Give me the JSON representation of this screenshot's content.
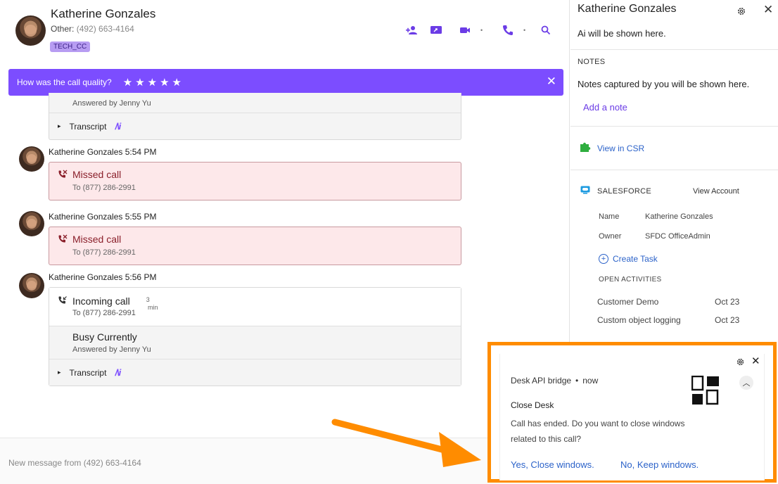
{
  "header": {
    "contact_name": "Katherine Gonzales",
    "phone_label": "Other:",
    "phone_number": "(492) 663-4164",
    "tag": "TECH_CC",
    "actions": [
      "add-user-icon",
      "screen-share-icon",
      "video-icon",
      "phone-icon",
      "search-icon"
    ]
  },
  "rating_bar": {
    "question": "How was the call quality?",
    "stars": [
      "★",
      "★",
      "★",
      "★",
      "★"
    ]
  },
  "timeline": {
    "first_card": {
      "answered_by": "Answered by Jenny Yu",
      "transcript_label": "Transcript",
      "transcript_caret": "▸",
      "ai_glyph": "/\\i"
    },
    "events": [
      {
        "author": "Katherine Gonzales",
        "time": "5:54 PM",
        "title": "Missed call",
        "to": "To (877) 286-2991"
      },
      {
        "author": "Katherine Gonzales",
        "time": "5:55 PM",
        "title": "Missed call",
        "to": "To (877) 286-2991"
      },
      {
        "author": "Katherine Gonzales",
        "time": "5:56 PM",
        "title": "Incoming call",
        "to": "To (877) 286-2991",
        "duration_value": "3",
        "duration_unit": "min",
        "status": "Busy Currently",
        "answered_by": "Answered by Jenny Yu",
        "transcript_label": "Transcript"
      }
    ]
  },
  "footer": {
    "text": "New message from (492) 663-4164"
  },
  "right_panel": {
    "name": "Katherine Gonzales",
    "ai_text": "Ai will be shown here.",
    "notes_heading": "NOTES",
    "notes_text": "Notes captured by you will be shown here.",
    "add_note": "Add a note",
    "view_csr": "View in CSR",
    "salesforce": {
      "heading": "SALESFORCE",
      "view_account": "View Account",
      "fields": [
        {
          "key": "Name",
          "value": "Katherine Gonzales"
        },
        {
          "key": "Owner",
          "value": "SFDC OfficeAdmin"
        }
      ],
      "create_task": "Create Task",
      "open_activities_heading": "OPEN ACTIVITIES",
      "activities": [
        {
          "name": "Customer Demo",
          "date": "Oct 23"
        },
        {
          "name": "Custom object logging",
          "date": "Oct 23"
        }
      ]
    }
  },
  "notification": {
    "app": "Desk API bridge",
    "dot": "•",
    "when": "now",
    "title": "Close Desk",
    "body": "Call has ended. Do you want to close windows related to this call?",
    "yes": "Yes, Close windows.",
    "no": "No, Keep windows.",
    "highlight_color": "#ff8c00"
  },
  "colors": {
    "accent": "#7c4dff",
    "link": "#2b62c9",
    "missed_bg": "#fde8ea",
    "missed_text": "#8a1f2a"
  }
}
